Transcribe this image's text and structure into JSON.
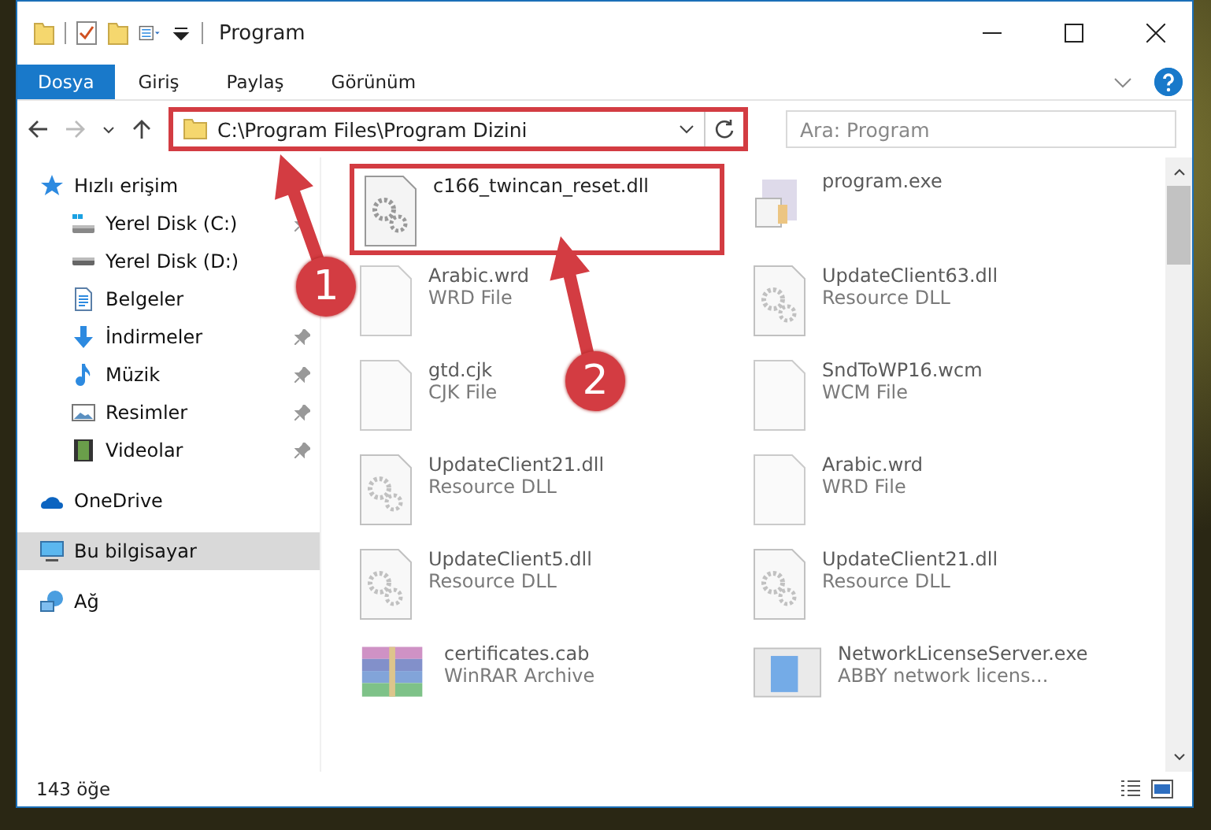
{
  "window": {
    "title": "Program"
  },
  "ribbon": {
    "tabs": [
      {
        "label": "Dosya",
        "selected": true
      },
      {
        "label": "Giriş",
        "selected": false
      },
      {
        "label": "Paylaş",
        "selected": false
      },
      {
        "label": "Görünüm",
        "selected": false
      }
    ]
  },
  "address": {
    "path": "C:\\Program Files\\Program Dizini",
    "highlighted": true
  },
  "search": {
    "placeholder": "Ara: Program"
  },
  "sidebar": {
    "items": [
      {
        "label": "Hızlı erişim",
        "kind": "star",
        "selected": false,
        "children": [
          {
            "label": "Yerel Disk (C:)",
            "kind": "drive-c",
            "pinned": true
          },
          {
            "label": "Yerel Disk (D:)",
            "kind": "drive",
            "pinned": false
          },
          {
            "label": "Belgeler",
            "kind": "docs",
            "pinned": false
          },
          {
            "label": "İndirmeler",
            "kind": "download",
            "pinned": true
          },
          {
            "label": "Müzik",
            "kind": "music",
            "pinned": true
          },
          {
            "label": "Resimler",
            "kind": "pictures",
            "pinned": true
          },
          {
            "label": "Videolar",
            "kind": "video",
            "pinned": true
          }
        ]
      },
      {
        "label": "OneDrive",
        "kind": "cloud",
        "selected": false
      },
      {
        "label": "Bu bilgisayar",
        "kind": "pc",
        "selected": true
      },
      {
        "label": "Ağ",
        "kind": "network",
        "selected": false
      }
    ]
  },
  "files": [
    {
      "name": "c166_twincan_reset.dll",
      "kind": "dll",
      "highlighted": true,
      "blurred": false
    },
    {
      "name": "program.exe",
      "kind": "exe",
      "highlighted": false,
      "blurred": true
    },
    {
      "name": "Arabic.wrd",
      "type": "WRD File",
      "kind": "blank",
      "highlighted": false,
      "blurred": true
    },
    {
      "name": "UpdateClient63.dll",
      "type": "Resource DLL",
      "kind": "dll",
      "highlighted": false,
      "blurred": true
    },
    {
      "name": "gtd.cjk",
      "type": "CJK File",
      "kind": "blank",
      "highlighted": false,
      "blurred": true
    },
    {
      "name": "SndToWP16.wcm",
      "type": "WCM File",
      "kind": "blank",
      "highlighted": false,
      "blurred": true
    },
    {
      "name": "UpdateClient21.dll",
      "type": "Resource DLL",
      "kind": "dll",
      "highlighted": false,
      "blurred": true
    },
    {
      "name": "Arabic.wrd",
      "type": "WRD File",
      "kind": "blank",
      "highlighted": false,
      "blurred": true
    },
    {
      "name": "UpdateClient5.dll",
      "type": "Resource DLL",
      "kind": "dll",
      "highlighted": false,
      "blurred": true
    },
    {
      "name": "UpdateClient21.dll",
      "type": "Resource DLL",
      "kind": "dll",
      "highlighted": false,
      "blurred": true
    },
    {
      "name": "certificates.cab",
      "type": "WinRAR Archive",
      "kind": "archive",
      "highlighted": false,
      "blurred": true
    },
    {
      "name": "NetworkLicenseServer.exe",
      "type": "ABBY network licens...",
      "kind": "app",
      "highlighted": false,
      "blurred": true
    }
  ],
  "annotations": [
    {
      "label": "1"
    },
    {
      "label": "2"
    }
  ],
  "status_bar": {
    "count": "143 öğe"
  }
}
